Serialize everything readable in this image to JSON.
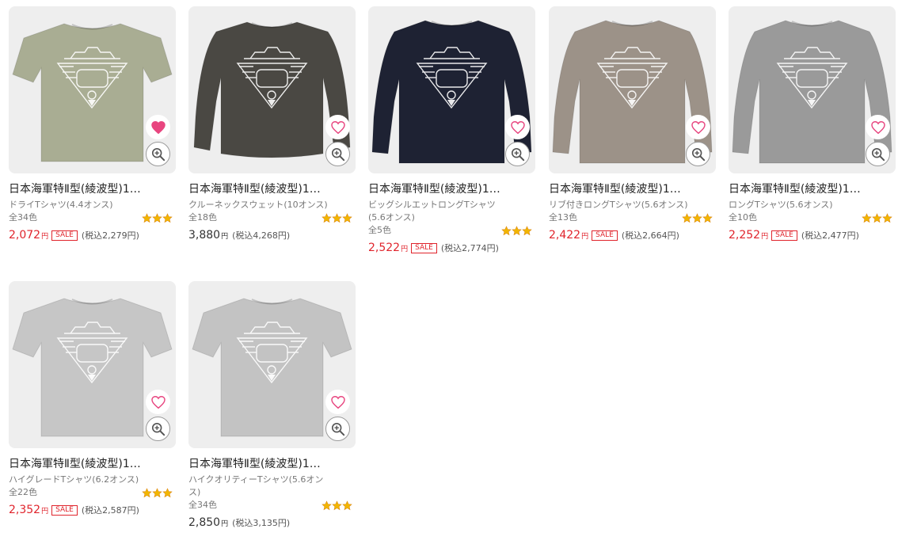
{
  "products": [
    {
      "title": "日本海軍特Ⅱ型(綾波型)1…",
      "type_line1": "ドライTシャツ(4.4オンス)",
      "type_line2": "",
      "colors": "全34色",
      "price": "2,072",
      "yen": "円",
      "sale_label": "SALE",
      "tax_in": "(税込2,279円)",
      "on_sale": true,
      "favorited": true,
      "rating": 3,
      "garment": "tshirt",
      "garment_color": "#a9ad93"
    },
    {
      "title": "日本海軍特Ⅱ型(綾波型)1…",
      "type_line1": "クルーネックスウェット(10オンス)",
      "type_line2": "",
      "colors": "全18色",
      "price": "3,880",
      "yen": "円",
      "sale_label": "",
      "tax_in": "(税込4,268円)",
      "on_sale": false,
      "favorited": false,
      "rating": 3,
      "garment": "sweat",
      "garment_color": "#4a4843"
    },
    {
      "title": "日本海軍特Ⅱ型(綾波型)1…",
      "type_line1": "ビッグシルエットロングTシャツ",
      "type_line2": "(5.6オンス)",
      "colors": "全5色",
      "price": "2,522",
      "yen": "円",
      "sale_label": "SALE",
      "tax_in": "(税込2,774円)",
      "on_sale": true,
      "favorited": false,
      "rating": 3,
      "garment": "longsleeve",
      "garment_color": "#1e2233"
    },
    {
      "title": "日本海軍特Ⅱ型(綾波型)1…",
      "type_line1": "リブ付きロングTシャツ(5.6オンス)",
      "type_line2": "",
      "colors": "全13色",
      "price": "2,422",
      "yen": "円",
      "sale_label": "SALE",
      "tax_in": "(税込2,664円)",
      "on_sale": true,
      "favorited": false,
      "rating": 3,
      "garment": "longsleeve",
      "garment_color": "#9c9288"
    },
    {
      "title": "日本海軍特Ⅱ型(綾波型)1…",
      "type_line1": "ロングTシャツ(5.6オンス)",
      "type_line2": "",
      "colors": "全10色",
      "price": "2,252",
      "yen": "円",
      "sale_label": "SALE",
      "tax_in": "(税込2,477円)",
      "on_sale": true,
      "favorited": false,
      "rating": 3,
      "garment": "longsleeve",
      "garment_color": "#9a9a9a"
    },
    {
      "title": "日本海軍特Ⅱ型(綾波型)1…",
      "type_line1": "ハイグレードTシャツ(6.2オンス)",
      "type_line2": "",
      "colors": "全22色",
      "price": "2,352",
      "yen": "円",
      "sale_label": "SALE",
      "tax_in": "(税込2,587円)",
      "on_sale": true,
      "favorited": false,
      "rating": 3,
      "garment": "tshirt",
      "garment_color": "#c6c6c6"
    },
    {
      "title": "日本海軍特Ⅱ型(綾波型)1…",
      "type_line1": "ハイクオリティーTシャツ(5.6オン",
      "type_line2": "ス)",
      "colors": "全34色",
      "price": "2,850",
      "yen": "円",
      "sale_label": "",
      "tax_in": "(税込3,135円)",
      "on_sale": false,
      "favorited": false,
      "rating": 3,
      "garment": "tshirt",
      "garment_color": "#c3c3c3"
    }
  ],
  "icons": {
    "favorite": "heart-icon",
    "zoom": "zoom-in-icon",
    "rating": "rating-emblem-icon"
  },
  "colors": {
    "sale_red": "#e0242c",
    "heart_pink": "#e8457f",
    "rating_gold": "#f2b600"
  }
}
